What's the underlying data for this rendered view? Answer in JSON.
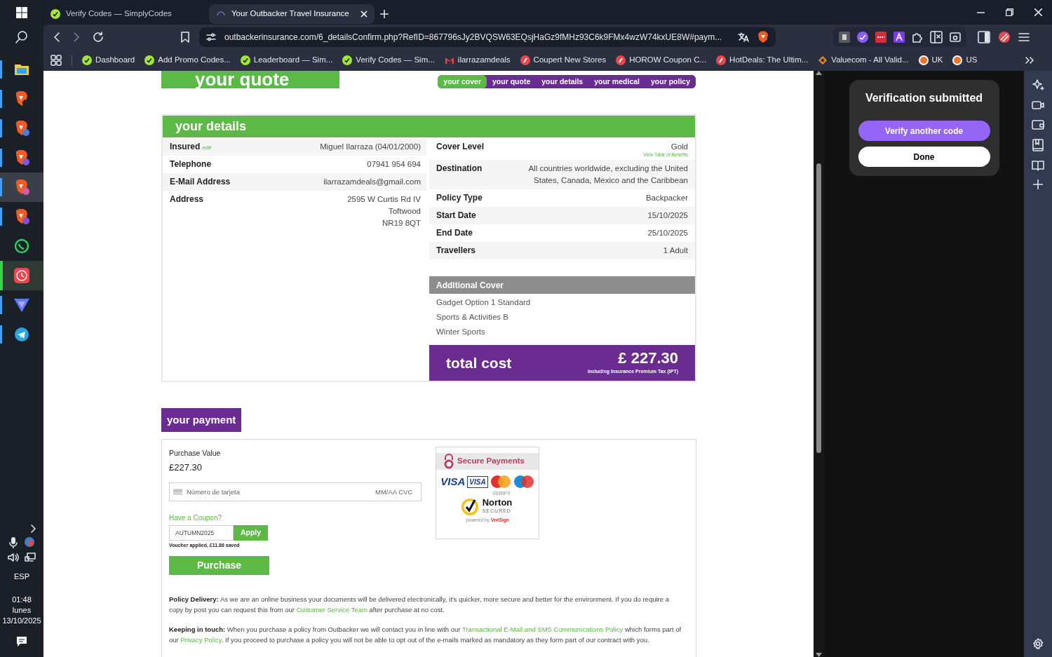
{
  "taskbar": {
    "apps": [
      {
        "kind": "files",
        "open": true,
        "alert": false,
        "selected": false
      },
      {
        "kind": "brave",
        "open": true,
        "alert": false,
        "selected": false,
        "color": "#222222"
      },
      {
        "kind": "brave",
        "open": true,
        "alert": false,
        "selected": false,
        "color": "#4a7fd6"
      },
      {
        "kind": "brave",
        "open": true,
        "alert": false,
        "selected": false,
        "color": "#7b5cd6"
      },
      {
        "kind": "brave",
        "open": true,
        "alert": false,
        "selected": true,
        "color": "#d65ca8"
      },
      {
        "kind": "brave",
        "open": true,
        "alert": false,
        "selected": false,
        "color": "#8a4fd0"
      },
      {
        "kind": "whatsapp",
        "open": false,
        "alert": false,
        "selected": false
      },
      {
        "kind": "clock",
        "open": false,
        "alert": true,
        "selected": false
      },
      {
        "kind": "vpn",
        "open": true,
        "alert": false,
        "selected": false
      },
      {
        "kind": "telegram",
        "open": true,
        "alert": false,
        "selected": false
      }
    ],
    "language": "ESP",
    "time": "01:48",
    "weekday": "lunes",
    "date": "13/10/2025"
  },
  "tabs": [
    {
      "title": "Verify Codes — SimplyCodes",
      "kind": "simplycodes",
      "selected": false
    },
    {
      "title": "Your Outbacker Travel Insurance",
      "kind": "loading",
      "selected": true
    }
  ],
  "address_bar": {
    "url": "outbackerinsurance.com/6_detailsConfirm.php?RefID=867796sJy2BVQSW63EQsjHaGz9fMHz93C6k9FMx4wzW74kxUE8W#paym..."
  },
  "bookmarks": [
    {
      "label": "Dashboard",
      "kind": "simplycodes"
    },
    {
      "label": "Add Promo Codes...",
      "kind": "simplycodes"
    },
    {
      "label": "Leaderboard — Sim...",
      "kind": "simplycodes"
    },
    {
      "label": "Verify Codes — Sim...",
      "kind": "simplycodes"
    },
    {
      "label": "ilarrazamdeals",
      "kind": "gmail"
    },
    {
      "label": "Coupert New Stores",
      "kind": "red"
    },
    {
      "label": "HOROW Coupon C...",
      "kind": "red"
    },
    {
      "label": "HotDeals: The Ultim...",
      "kind": "red"
    },
    {
      "label": "Valuecom - All Valid...",
      "kind": "valuecom"
    },
    {
      "label": "UK",
      "kind": "rakuten"
    },
    {
      "label": "US",
      "kind": "rakuten"
    }
  ],
  "page": {
    "heading": "your quote",
    "steps": [
      {
        "label": "your cover",
        "selected": true
      },
      {
        "label": "your quote",
        "selected": false
      },
      {
        "label": "your details",
        "selected": false
      },
      {
        "label": "your medical",
        "selected": false
      },
      {
        "label": "your policy",
        "selected": false
      }
    ],
    "details": {
      "title": "your details",
      "left": [
        {
          "label": "Insured",
          "edit": "edit",
          "lines": [
            "Miguel Ilarraza (04/01/2000)"
          ]
        },
        {
          "label": "Telephone",
          "lines": [
            "07941 954 694"
          ]
        },
        {
          "label": "E-Mail Address",
          "lines": [
            "ilarrazamdeals@gmail.com"
          ]
        },
        {
          "label": "Address",
          "lines": [
            "2595 W Curtis Rd IV",
            "Toftwood",
            "NR19 8QT"
          ]
        }
      ],
      "right": [
        {
          "label": "Cover Level",
          "value": "Gold",
          "note": "View Table of Benefits"
        },
        {
          "label": "Destination",
          "value": "All countries worldwide, excluding the United States, Canada, Mexico and the Caribbean"
        },
        {
          "label": "Policy Type",
          "value": "Backpacker"
        },
        {
          "label": "Start Date",
          "value": "15/10/2025"
        },
        {
          "label": "End Date",
          "value": "25/10/2025"
        },
        {
          "label": "Travellers",
          "value": "1 Adult"
        }
      ],
      "additional_cover": {
        "title": "Additional Cover",
        "items": [
          "Gadget Option 1 Standard",
          "Sports & Activities B",
          "Winter Sports"
        ]
      },
      "total": {
        "label": "total cost",
        "amount": "£ 227.30",
        "note": "including Insurance Premium Tax (IPT)"
      }
    },
    "payment": {
      "title": "your payment",
      "value_label": "Purchase Value",
      "value": "£227.30",
      "card_field": {
        "placeholder": "Número de tarjeta",
        "expiry_placeholder": "MM/AA CVC"
      },
      "coupon_link": "Have a Coupon?",
      "coupon_value": "AUTUMN2025",
      "apply": "Apply",
      "coupon_note": "Voucher applied, £11.86 saved",
      "purchase": "Purchase",
      "badge": {
        "title": "Secure Payments",
        "card_logos": [
          "VISA",
          "VISA"
        ],
        "verify": "VERIFY",
        "norton": "Norton",
        "secured": "SECURED",
        "powered": "powered by",
        "verisign": "VeriSign"
      },
      "paragraphs": [
        {
          "lead": "Policy Delivery:",
          "parts": [
            {
              "text": " As we are an online business your documents will be delivered electronically, it's quicker, more secure and better for the environment. If you do require a copy by post you can request this from our ",
              "link": false
            },
            {
              "text": "Customer Service Team",
              "link": true
            },
            {
              "text": " after purchase at no cost.",
              "link": false
            }
          ]
        },
        {
          "lead": "Keeping in touch:",
          "parts": [
            {
              "text": " When you purchase a policy from Outbacker we will contact you in line with our ",
              "link": false
            },
            {
              "text": "Transactional E-Mail and SMS Communications Policy",
              "link": true
            },
            {
              "text": " which forms part of our ",
              "link": false
            },
            {
              "text": "Privacy Policy",
              "link": true
            },
            {
              "text": ". If you proceed to purchase a policy you will not be able to opt out of the e-mails marked as mandatory as they form part of our contract with you.",
              "link": false
            }
          ]
        }
      ]
    }
  },
  "side_panel": {
    "title": "Verification submitted",
    "primary": "Verify another code",
    "secondary": "Done"
  }
}
